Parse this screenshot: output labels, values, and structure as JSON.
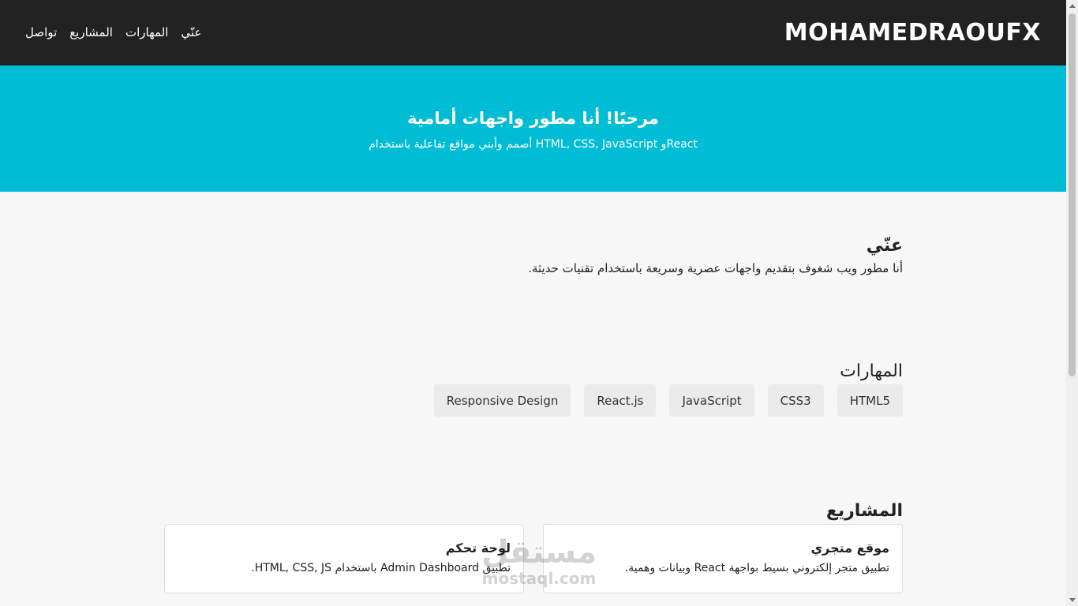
{
  "navbar": {
    "logo": "MOHAMEDRAOUFX",
    "links": [
      "عنّي",
      "المهارات",
      "المشاريع",
      "تواصل"
    ]
  },
  "hero": {
    "title": "مرحبًا! أنا مطور واجهات أمامية",
    "subtitle": "أصمم وأبني مواقع تفاعلية باستخدام HTML, CSS, JavaScript وReact"
  },
  "about": {
    "title": "عنّي",
    "text": "أنا مطور ويب شغوف بتقديم واجهات عصرية وسريعة باستخدام تقنيات حديثة."
  },
  "skills": {
    "title": "المهارات",
    "items": [
      "HTML5",
      "CSS3",
      "JavaScript",
      "React.js",
      "Responsive Design"
    ]
  },
  "projects": {
    "title": "المشاريع",
    "items": [
      {
        "title": "موقع متجري",
        "description": "تطبيق متجر إلكتروني بسيط بواجهة React وبيانات وهمية."
      },
      {
        "title": "لوحة تحكم",
        "description": "تطبيق Admin Dashboard باستخدام HTML, CSS, JS."
      }
    ]
  },
  "watermark": {
    "arabic": "مستقل",
    "latin": "mostaql.com"
  },
  "colors": {
    "navbar": "#222222",
    "hero": "#00bcd4",
    "background": "#f7f7f7",
    "chip": "#ebebeb"
  }
}
